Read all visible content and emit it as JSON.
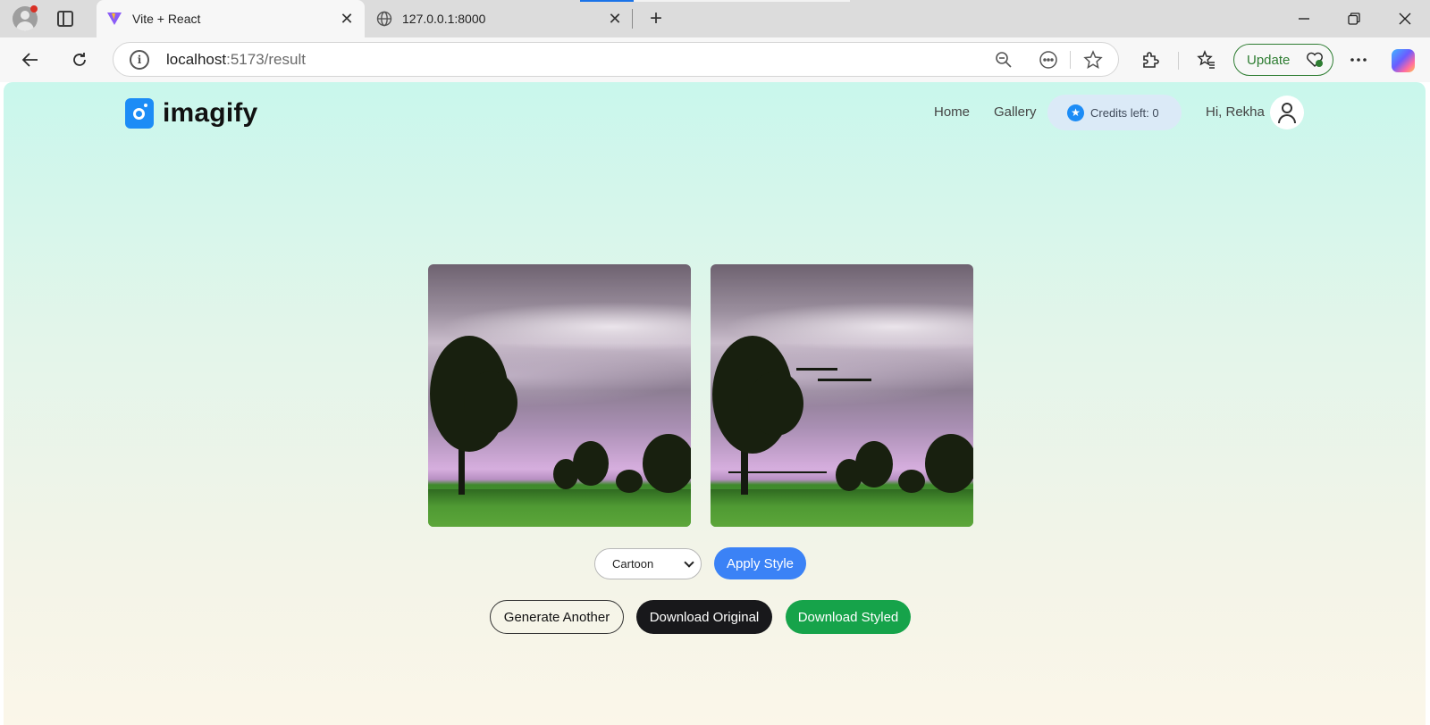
{
  "browser": {
    "tabs": [
      {
        "title": "Vite + React",
        "active": true,
        "favicon": "vite-logo-icon"
      },
      {
        "title": "127.0.0.1:8000",
        "active": false,
        "favicon": "globe-icon"
      }
    ],
    "address": {
      "host": "localhost",
      "rest": ":5173/result"
    },
    "update_label": "Update"
  },
  "navbar": {
    "brand": "imagify",
    "links": [
      "Home",
      "Gallery"
    ],
    "credits": "Credits left: 0",
    "greeting": "Hi, Rekha"
  },
  "result": {
    "images": [
      {
        "label": "original-image"
      },
      {
        "label": "styled-image"
      }
    ],
    "style_select": {
      "value": "Cartoon"
    },
    "apply_label": "Apply Style",
    "actions": {
      "generate": "Generate Another",
      "download_original": "Download Original",
      "download_styled": "Download Styled"
    }
  },
  "colors": {
    "primary_blue": "#3b82f6",
    "dark_button": "#18181b",
    "green_button": "#16a34a",
    "brand_blue": "#1c8cf6"
  }
}
